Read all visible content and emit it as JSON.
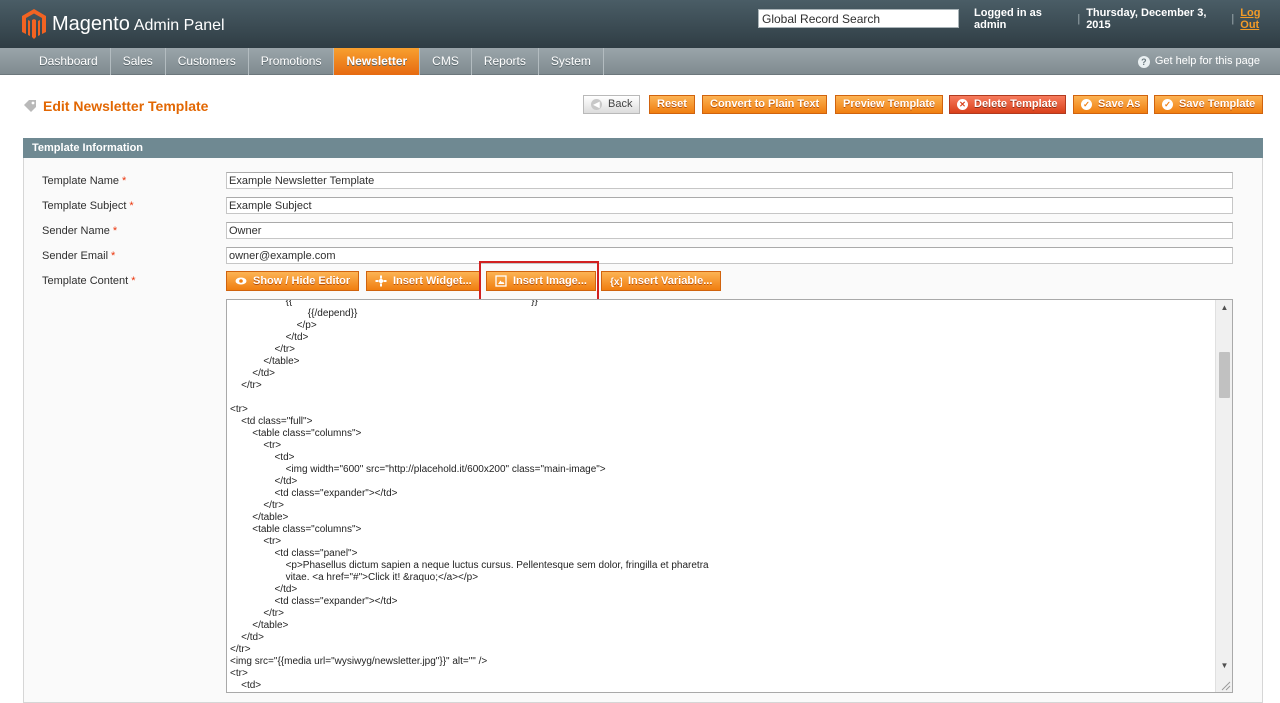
{
  "header": {
    "logo_brand": "Magento",
    "logo_sub": "Admin Panel",
    "search_value": "Global Record Search",
    "logged_in": "Logged in as admin",
    "date": "Thursday, December 3, 2015",
    "logout": "Log Out",
    "colors": {
      "bar": "#2f3d44",
      "accent": "#f39b27"
    }
  },
  "nav": {
    "items": [
      "Dashboard",
      "Sales",
      "Customers",
      "Promotions",
      "Newsletter",
      "CMS",
      "Reports",
      "System"
    ],
    "active": "Newsletter",
    "help": "Get help for this page",
    "colors": {
      "bar": "#8a969b",
      "active": "#eb7a1a"
    }
  },
  "page": {
    "title": "Edit Newsletter Template",
    "buttons": {
      "back": "Back",
      "reset": "Reset",
      "convert": "Convert to Plain Text",
      "preview": "Preview Template",
      "delete": "Delete Template",
      "save_as": "Save As",
      "save": "Save Template"
    }
  },
  "form": {
    "section_title": "Template Information",
    "required_mark": "*",
    "fields": {
      "name": {
        "label": "Template Name",
        "value": "Example Newsletter Template"
      },
      "subject": {
        "label": "Template Subject",
        "value": "Example Subject"
      },
      "sender_name": {
        "label": "Sender Name",
        "value": "Owner"
      },
      "sender_email": {
        "label": "Sender Email",
        "value": "owner@example.com"
      },
      "content": {
        "label": "Template Content"
      }
    },
    "editor_buttons": {
      "show_hide": "Show / Hide Editor",
      "insert_widget": "Insert Widget...",
      "insert_image": "Insert Image...",
      "insert_variable": "Insert Variable..."
    },
    "highlighted_button": "insert_image",
    "content_code": "                    {{                                                                                      }}\n                            {{/depend}}\n                        </p>\n                    </td>\n                </tr>\n            </table>\n        </td>\n    </tr>\n\n<tr>\n    <td class=\"full\">\n        <table class=\"columns\">\n            <tr>\n                <td>\n                    <img width=\"600\" src=\"http://placehold.it/600x200\" class=\"main-image\">\n                </td>\n                <td class=\"expander\"></td>\n            </tr>\n        </table>\n        <table class=\"columns\">\n            <tr>\n                <td class=\"panel\">\n                    <p>Phasellus dictum sapien a neque luctus cursus. Pellentesque sem dolor, fringilla et pharetra\n                    vitae. <a href=\"#\">Click it! &raquo;</a></p>\n                </td>\n                <td class=\"expander\"></td>\n            </tr>\n        </table>\n    </td>\n</tr>\n<img src=\"{{media url=\"wysiwyg/newsletter.jpg\"}}\" alt=\"\" />\n<tr>\n    <td>\n        <table class=\"row\">"
  }
}
